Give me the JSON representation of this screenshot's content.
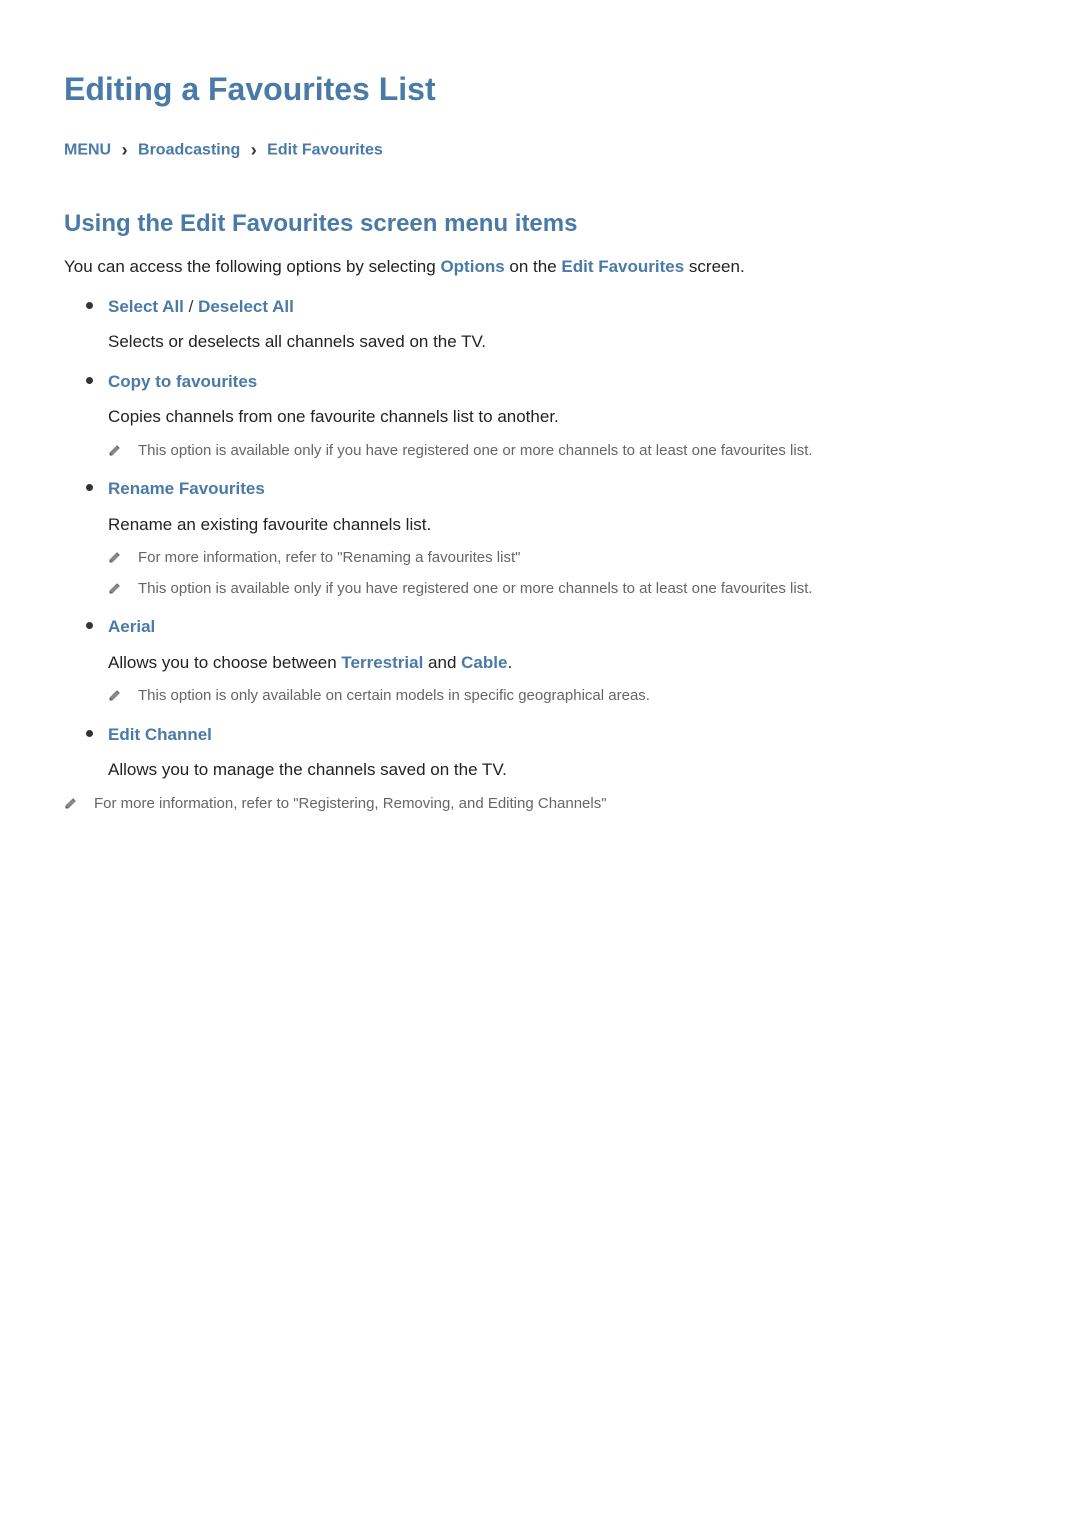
{
  "page_title": "Editing a Favourites List",
  "breadcrumb": {
    "menu": "MENU",
    "item1": "Broadcasting",
    "item2": "Edit Favourites"
  },
  "section_title": "Using the Edit Favourites screen menu items",
  "intro": {
    "prefix": "You can access the following options by selecting ",
    "options_word": "Options",
    "middle": " on the ",
    "screen_word": "Edit Favourites",
    "suffix": " screen."
  },
  "options": [
    {
      "title_parts": [
        "Select All",
        " / ",
        "Deselect All"
      ],
      "desc": "Selects or deselects all channels saved on the TV.",
      "notes": []
    },
    {
      "title_parts": [
        "Copy to favourites"
      ],
      "desc": "Copies channels from one favourite channels list to another.",
      "notes": [
        "This option is available only if you have registered one or more channels to at least one favourites list."
      ]
    },
    {
      "title_parts": [
        "Rename Favourites"
      ],
      "desc": "Rename an existing favourite channels list.",
      "notes": [
        "For more information, refer to \"Renaming a favourites list\"",
        "This option is available only if you have registered one or more channels to at least one favourites list."
      ]
    },
    {
      "title_parts": [
        "Aerial"
      ],
      "desc_rich": {
        "prefix": "Allows you to choose between ",
        "hl1": "Terrestrial",
        "mid": " and ",
        "hl2": "Cable",
        "suffix": "."
      },
      "notes": [
        "This option is only available on certain models in specific geographical areas."
      ]
    },
    {
      "title_parts": [
        "Edit Channel"
      ],
      "desc": "Allows you to manage the channels saved on the TV.",
      "notes": [
        "For more information, refer to \"Registering, Removing, and Editing Channels\""
      ]
    }
  ]
}
